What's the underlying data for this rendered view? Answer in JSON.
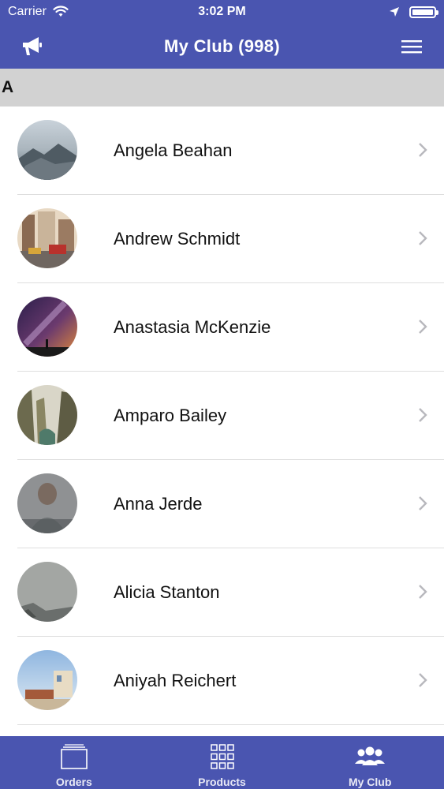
{
  "status_bar": {
    "carrier": "Carrier",
    "time": "3:02 PM"
  },
  "nav": {
    "title": "My Club (998)",
    "left_icon": "megaphone-icon",
    "right_icon": "hamburger-menu-icon"
  },
  "section": {
    "header": "A"
  },
  "members": [
    {
      "name": "Angela Beahan",
      "avatar": "mountain-fog-photo"
    },
    {
      "name": "Andrew Schmidt",
      "avatar": "city-street-photo"
    },
    {
      "name": "Anastasia McKenzie",
      "avatar": "milky-way-photo"
    },
    {
      "name": "Amparo Bailey",
      "avatar": "rocky-canyon-photo"
    },
    {
      "name": "Anna Jerde",
      "avatar": "misty-portrait-photo"
    },
    {
      "name": "Alicia Stanton",
      "avatar": "foggy-coast-photo"
    },
    {
      "name": "Aniyah Reichert",
      "avatar": "seaside-house-photo"
    }
  ],
  "tabs": [
    {
      "label": "Orders",
      "icon": "orders-tray-icon"
    },
    {
      "label": "Products",
      "icon": "grid-icon"
    },
    {
      "label": "My Club",
      "icon": "people-icon"
    }
  ],
  "colors": {
    "primary": "#4a55b0",
    "section_bg": "#d2d2d2",
    "divider": "#dedede"
  }
}
